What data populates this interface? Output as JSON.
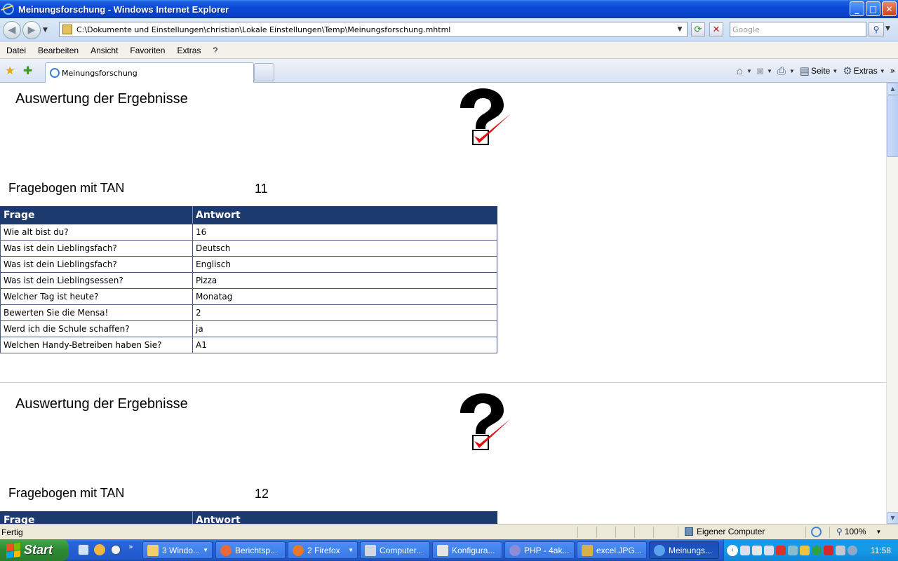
{
  "window": {
    "title": "Meinungsforschung - Windows Internet Explorer",
    "min": "_",
    "max": "□",
    "close": "✕"
  },
  "address": {
    "url": "C:\\Dokumente und Einstellungen\\christian\\Lokale Einstellungen\\Temp\\Meinungsforschung.mhtml"
  },
  "search": {
    "placeholder": "Google"
  },
  "menu": [
    "Datei",
    "Bearbeiten",
    "Ansicht",
    "Favoriten",
    "Extras",
    "?"
  ],
  "tab": {
    "label": "Meinungsforschung"
  },
  "commands": {
    "seite": "Seite",
    "extras": "Extras"
  },
  "page": {
    "sections": [
      {
        "heading": "Auswertung der Ergebnisse",
        "tan_label": "Fragebogen mit TAN",
        "tan_value": "11",
        "columns": [
          "Frage",
          "Antwort"
        ],
        "rows": [
          [
            "Wie alt bist du?",
            "16"
          ],
          [
            "Was ist dein Lieblingsfach?",
            "Deutsch"
          ],
          [
            "Was ist dein Lieblingsfach?",
            "Englisch"
          ],
          [
            "Was ist dein Lieblingsessen?",
            "Pizza"
          ],
          [
            "Welcher Tag ist heute?",
            "Monatag"
          ],
          [
            "Bewerten Sie die Mensa!",
            "2"
          ],
          [
            "Werd ich die Schule schaffen?",
            "ja"
          ],
          [
            "Welchen Handy-Betreiben haben Sie?",
            "A1"
          ]
        ]
      },
      {
        "heading": "Auswertung der Ergebnisse",
        "tan_label": "Fragebogen mit TAN",
        "tan_value": "12",
        "columns": [
          "Frage",
          "Antwort"
        ],
        "rows": []
      }
    ]
  },
  "status": {
    "text": "Fertig",
    "zone": "Eigener Computer",
    "zoom": "100%"
  },
  "taskbar": {
    "start": "Start",
    "tasks": [
      "3 Windo...",
      "Berichtsp...",
      "2 Firefox",
      "Computer...",
      "Konfigura...",
      "PHP - 4ak...",
      "excel.JPG...",
      "Meinungs..."
    ],
    "clock": "11:58"
  }
}
